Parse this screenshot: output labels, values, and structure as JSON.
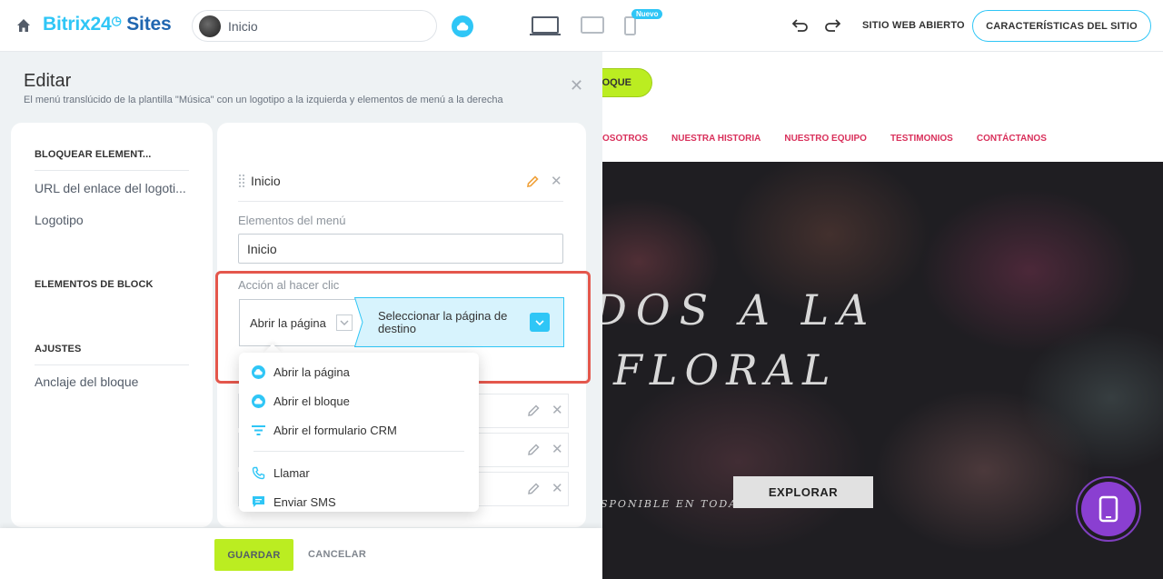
{
  "header": {
    "brand_part1": "Bitrix24",
    "brand_part2": "Sites",
    "page_select_value": "Inicio",
    "new_badge": "Nuevo",
    "open_site_label": "SITIO WEB ABIERTO",
    "site_features_label": "CARACTERÍSTICAS DEL SITIO"
  },
  "preview": {
    "block_button_label": "LOQUE",
    "nav_items": [
      "OSOTROS",
      "NUESTRA HISTORIA",
      "NUESTRO EQUIPO",
      "TESTIMONIOS",
      "CONTÁCTANOS"
    ],
    "hero_title_line1": "DOS A LA",
    "hero_title_line2": "FLORAL",
    "hero_subtitle": "SPONIBLE EN TODA",
    "explore_label": "EXPLORAR"
  },
  "editor": {
    "title": "Editar",
    "description": "El menú translúcido de la plantilla \"Música\" con un logotipo a la izquierda y elementos de menú a la derecha",
    "sidebar": {
      "section_lock": "BLOQUEAR ELEMENT...",
      "item_logo_url": "URL del enlace del logoti...",
      "item_logo": "Logotipo",
      "section_elements": "ELEMENTOS DE BLOCK",
      "section_settings": "AJUSTES",
      "item_anchor": "Anclaje del bloque"
    },
    "menu_item_name": "Inicio",
    "menu_elements_label": "Elementos del menú",
    "menu_elements_value": "Inicio",
    "click_action_label": "Acción al hacer clic",
    "click_action_value": "Abrir la página",
    "target_page_label": "Seleccionar la página de destino",
    "dropdown_options": [
      {
        "label": "Abrir la página",
        "icon": "cloud-icon"
      },
      {
        "label": "Abrir el bloque",
        "icon": "cloud-icon"
      },
      {
        "label": "Abrir el formulario CRM",
        "icon": "filter-icon"
      },
      {
        "label": "Llamar",
        "icon": "phone-icon"
      },
      {
        "label": "Enviar SMS",
        "icon": "chat-icon"
      }
    ],
    "save_label": "GUARDAR",
    "cancel_label": "CANCELAR"
  },
  "colors": {
    "accent_blue": "#2fc6f6",
    "brand_dark_blue": "#2066b0",
    "save_green": "#bbed21",
    "highlight_red": "#e4574c",
    "nav_pink": "#d9305b",
    "fab_purple": "#8a3fd1"
  }
}
